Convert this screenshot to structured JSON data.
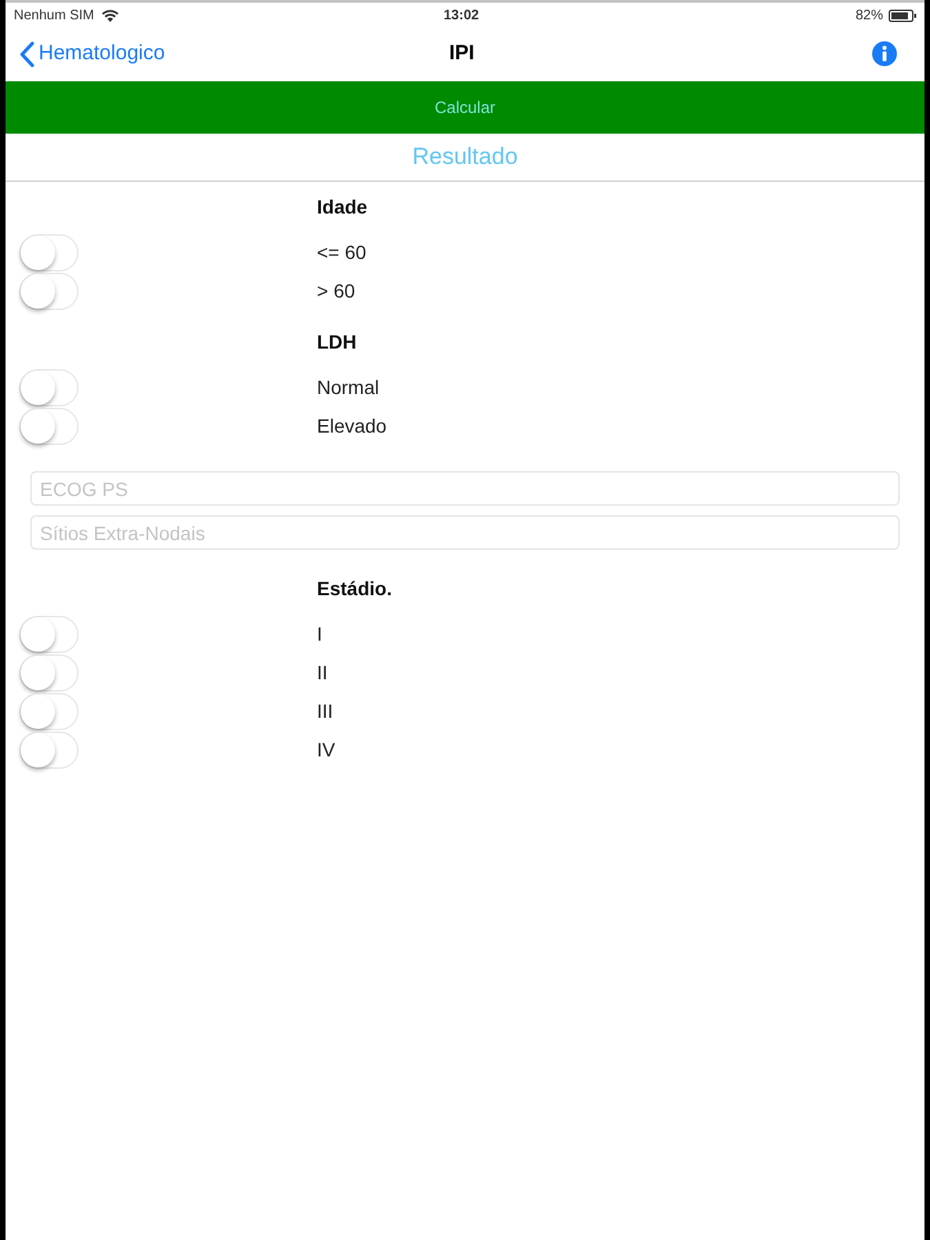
{
  "status_bar": {
    "carrier": "Nenhum SIM",
    "time": "13:02",
    "battery": "82%"
  },
  "nav_bar": {
    "back_label": "Hematologico",
    "title": "IPI"
  },
  "calculate_button": {
    "label": "Calcular"
  },
  "result": {
    "label": "Resultado"
  },
  "sections": [
    {
      "kind": "toggles",
      "title": "Idade",
      "options": [
        {
          "label": "<= 60",
          "on": false
        },
        {
          "label": "> 60",
          "on": false
        }
      ]
    },
    {
      "kind": "toggles",
      "title": "LDH",
      "options": [
        {
          "label": "Normal",
          "on": false
        },
        {
          "label": "Elevado",
          "on": false
        }
      ]
    },
    {
      "kind": "fields",
      "fields": [
        {
          "placeholder": "ECOG PS"
        },
        {
          "placeholder": "Sítios Extra-Nodais"
        }
      ]
    },
    {
      "kind": "toggles",
      "title": "Estádio.",
      "options": [
        {
          "label": "I",
          "on": false
        },
        {
          "label": "II",
          "on": false
        },
        {
          "label": "III",
          "on": false
        },
        {
          "label": "IV",
          "on": false
        }
      ]
    }
  ]
}
